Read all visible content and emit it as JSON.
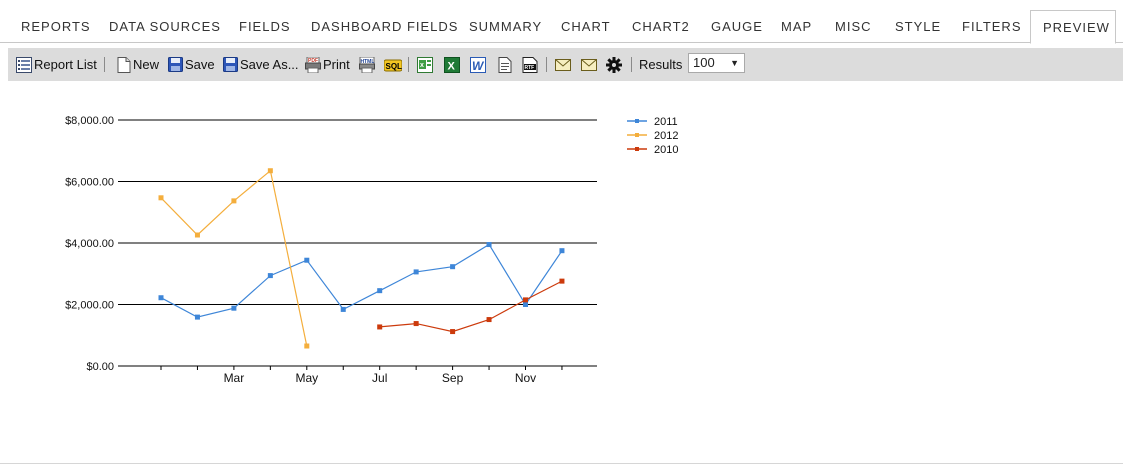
{
  "tabs": [
    {
      "label": "REPORTS",
      "active": false
    },
    {
      "label": "DATA SOURCES",
      "active": false
    },
    {
      "label": "FIELDS",
      "active": false
    },
    {
      "label": "DASHBOARD FIELDS",
      "active": false
    },
    {
      "label": "SUMMARY",
      "active": false
    },
    {
      "label": "CHART",
      "active": false
    },
    {
      "label": "CHART2",
      "active": false
    },
    {
      "label": "GAUGE",
      "active": false
    },
    {
      "label": "MAP",
      "active": false
    },
    {
      "label": "MISC",
      "active": false
    },
    {
      "label": "STYLE",
      "active": false
    },
    {
      "label": "FILTERS",
      "active": false
    },
    {
      "label": "PREVIEW",
      "active": true
    }
  ],
  "toolbar": {
    "report_list": {
      "label": "Report List",
      "icon": "list-icon"
    },
    "new": {
      "label": "New",
      "icon": "new-document-icon"
    },
    "save": {
      "label": "Save",
      "icon": "floppy-disk-icon"
    },
    "save_as": {
      "label": "Save As...",
      "icon": "floppy-disk-icon"
    },
    "print": {
      "label": "Print",
      "icon": "pdf-print-icon"
    },
    "export_icons": [
      "html-export-icon",
      "sql-export-icon",
      "csv-export-icon",
      "excel-export-icon",
      "word-export-icon",
      "text-export-icon",
      "rtf-export-icon"
    ],
    "email_icons": [
      "envelope-icon",
      "envelope-icon"
    ],
    "settings_icon": "gear-icon",
    "results_label": "Results",
    "results_value": "100"
  },
  "chart_data": {
    "type": "line",
    "y_ticks": [
      "$0.00",
      "$2,000.00",
      "$4,000.00",
      "$6,000.00",
      "$8,000.00"
    ],
    "ylim": [
      0,
      8000
    ],
    "x_ticks": [
      {
        "label": "Mar",
        "index": 2
      },
      {
        "label": "May",
        "index": 4
      },
      {
        "label": "Jul",
        "index": 6
      },
      {
        "label": "Sep",
        "index": 8
      },
      {
        "label": "Nov",
        "index": 10
      }
    ],
    "x_count": 12,
    "grid": true,
    "legend_position": "right",
    "series": [
      {
        "name": "2011",
        "color": "#3e86d8",
        "values": [
          2220,
          1590,
          1880,
          2940,
          3440,
          1840,
          2450,
          3060,
          3230,
          3950,
          2000,
          3750
        ]
      },
      {
        "name": "2012",
        "color": "#f4ae3c",
        "values": [
          5470,
          4260,
          5370,
          6350,
          650,
          null,
          null,
          null,
          null,
          null,
          null,
          null
        ]
      },
      {
        "name": "2010",
        "color": "#cc3a0c",
        "values": [
          null,
          null,
          null,
          null,
          null,
          null,
          1270,
          1380,
          1120,
          1510,
          2150,
          2760
        ]
      }
    ]
  }
}
